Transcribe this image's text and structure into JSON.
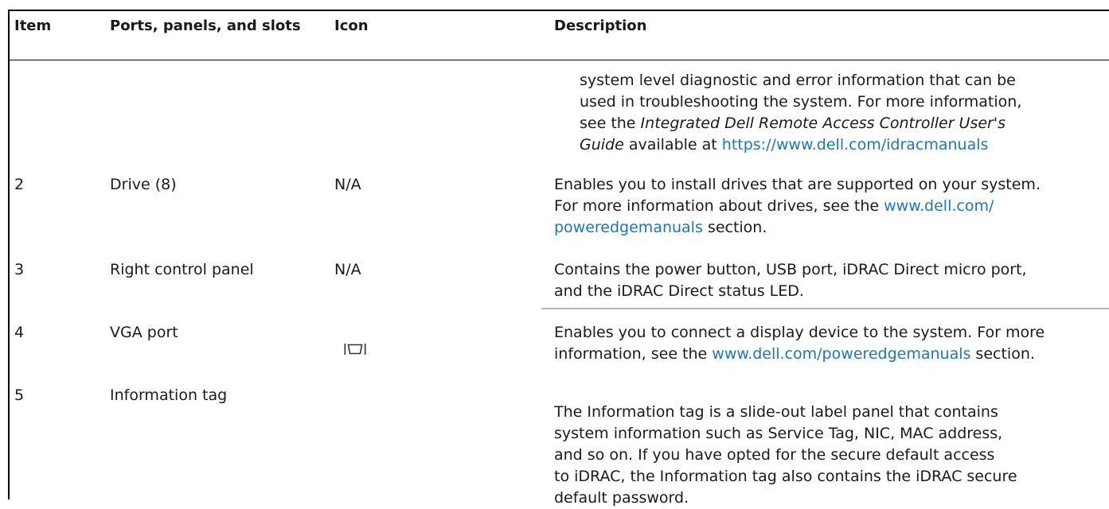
{
  "header": {
    "item": "Item",
    "ports": "Ports, panels, and slots",
    "icon": "Icon",
    "description": "Description"
  },
  "continued_description": {
    "line1": "system level diagnostic and error information that can be",
    "line2": "used in troubleshooting the system. For more information,",
    "line3_prefix": "see the ",
    "guide_title_part1": "Integrated Dell Remote Access Controller User's",
    "guide_title_part2": "Guide",
    "line4_mid": " available at ",
    "link": "https://www.dell.com/idracmanuals"
  },
  "rows": [
    {
      "item": "2",
      "ports": "Drive (8)",
      "icon": "N/A",
      "desc_line1": "Enables you to install drives that are supported on your system.",
      "desc_line2_prefix": "For more information about drives, see the ",
      "desc_link_part1": "www.dell.com/",
      "desc_link_part2": "poweredgemanuals",
      "desc_suffix": " section."
    },
    {
      "item": "3",
      "ports": "Right control panel",
      "icon": "N/A",
      "desc_line1": "Contains the power button, USB port, iDRAC Direct micro port,",
      "desc_line2": "and the iDRAC Direct status LED."
    },
    {
      "item": "4",
      "ports": "VGA port",
      "icon": "vga-port-icon",
      "desc_line1": "Enables you to connect a display device to the system. For more",
      "desc_line2_prefix": "information, see the ",
      "desc_link": "www.dell.com/poweredgemanuals",
      "desc_suffix": " section."
    },
    {
      "item": "5",
      "ports": "Information tag",
      "icon": "",
      "desc_line1": "The Information tag is a slide-out label panel that contains",
      "desc_line2": "system information such as Service Tag, NIC, MAC address,",
      "desc_line3": "and so on. If you have opted for the secure default access",
      "desc_line4": "to iDRAC, the Information tag also contains the iDRAC secure",
      "desc_line5": "default password."
    }
  ]
}
